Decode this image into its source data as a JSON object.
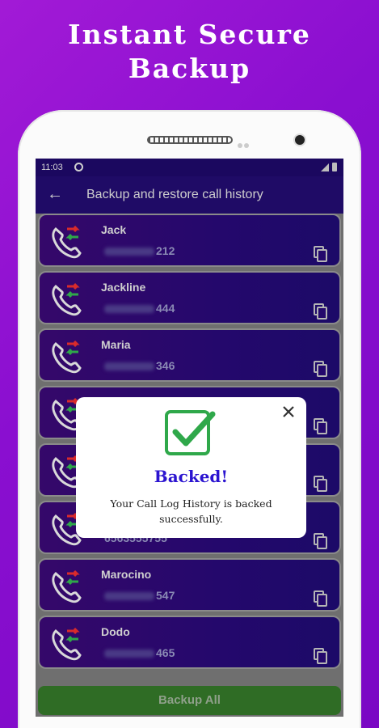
{
  "promo": {
    "line1": "Instant Secure",
    "line2": "Backup"
  },
  "status_bar": {
    "time": "11:03"
  },
  "app_bar": {
    "title": "Backup and restore call history"
  },
  "contacts": [
    {
      "name": "Jack",
      "number_suffix": "212"
    },
    {
      "name": "Jackline",
      "number_suffix": "444"
    },
    {
      "name": "Maria",
      "number_suffix": "346"
    },
    {
      "name": "",
      "number_suffix": ""
    },
    {
      "name": "",
      "number_suffix": ""
    },
    {
      "name": "",
      "number_suffix": "6563555755"
    },
    {
      "name": "Marocino",
      "number_suffix": "547"
    },
    {
      "name": "Dodo",
      "number_suffix": "465"
    }
  ],
  "backup_button": {
    "label": "Backup All"
  },
  "dialog": {
    "title": "Backed!",
    "message": "Your Call Log History is backed successfully."
  },
  "colors": {
    "background": "#9a14d4",
    "appbar": "#1f0b66",
    "dialog_title": "#2b14d0",
    "check": "#2fa84a",
    "backup_button": "#2f6c25"
  }
}
